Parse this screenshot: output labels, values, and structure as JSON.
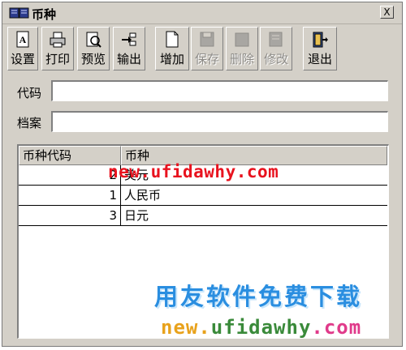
{
  "window": {
    "title": "币种",
    "close_glyph": "X"
  },
  "toolbar": {
    "buttons": [
      {
        "label": "设置",
        "icon": "page-setup-icon",
        "enabled": true
      },
      {
        "label": "打印",
        "icon": "printer-icon",
        "enabled": true
      },
      {
        "label": "预览",
        "icon": "preview-icon",
        "enabled": true
      },
      {
        "label": "输出",
        "icon": "export-icon",
        "enabled": true
      },
      {
        "label": "增加",
        "icon": "new-document-icon",
        "enabled": true
      },
      {
        "label": "保存",
        "icon": "save-icon",
        "enabled": false
      },
      {
        "label": "删除",
        "icon": "delete-icon",
        "enabled": false
      },
      {
        "label": "修改",
        "icon": "edit-icon",
        "enabled": false
      },
      {
        "label": "退出",
        "icon": "exit-door-icon",
        "enabled": true
      }
    ]
  },
  "form": {
    "code_label": "代码",
    "code_value": "",
    "archive_label": "档案",
    "archive_value": ""
  },
  "grid": {
    "columns": [
      "币种代码",
      "币种"
    ],
    "rows": [
      {
        "code": "2",
        "name": "美元"
      },
      {
        "code": "1",
        "name": "人民币"
      },
      {
        "code": "3",
        "name": "日元"
      }
    ]
  },
  "watermarks": {
    "url_top": "new.ufidawhy.com",
    "banner": "用友软件免费下载",
    "url_bottom_a": "new.",
    "url_bottom_b": "ufidawhy",
    "url_bottom_c": ".com"
  },
  "colors": {
    "window_bg": "#d4d0c8",
    "watermark_red": "#e8121e",
    "banner_blue": "#2a8ee0"
  }
}
